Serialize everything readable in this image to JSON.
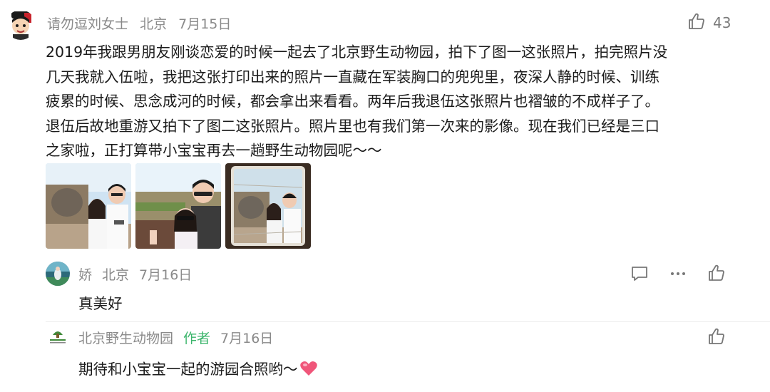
{
  "main_comment": {
    "username": "请勿逗刘女士",
    "location": "北京",
    "date": "7月15日",
    "like_count": "43",
    "text_lines": [
      "2019年我跟男朋友刚谈恋爱的时候一起去了北京野生动物园，拍下了图一这张照片，拍完照片没",
      "几天我就入伍啦，我把这张打印出来的照片一直藏在军装胸口的兜兜里，夜深人静的时候、训练",
      "疲累的时候、思念成河的时候，都会拿出来看看。两年后我退伍这张照片也褶皱的不成样子了。",
      "退伍后故地重游又拍下了图二这张照片。照片里也有我们第一次来的影像。现在我们已经是三口",
      "之家啦，正打算带小宝宝再去一趟野生动物园呢～～"
    ],
    "photos": [
      "photo-1",
      "photo-2",
      "photo-3"
    ]
  },
  "replies": [
    {
      "username": "娇",
      "location": "北京",
      "date": "7月16日",
      "text": "真美好"
    },
    {
      "username": "北京野生动物园",
      "author_tag": "作者",
      "date": "7月16日",
      "text": "期待和小宝宝一起的游园合照哟～"
    }
  ],
  "colors": {
    "meta_gray": "#8a8a8a",
    "author_green": "#3bb56b",
    "heart_pink": "#f0567a"
  },
  "icons": {
    "like": "thumbs-up-icon",
    "reply": "comment-icon",
    "more": "more-dots-icon",
    "heart": "heart-emoji-icon"
  }
}
